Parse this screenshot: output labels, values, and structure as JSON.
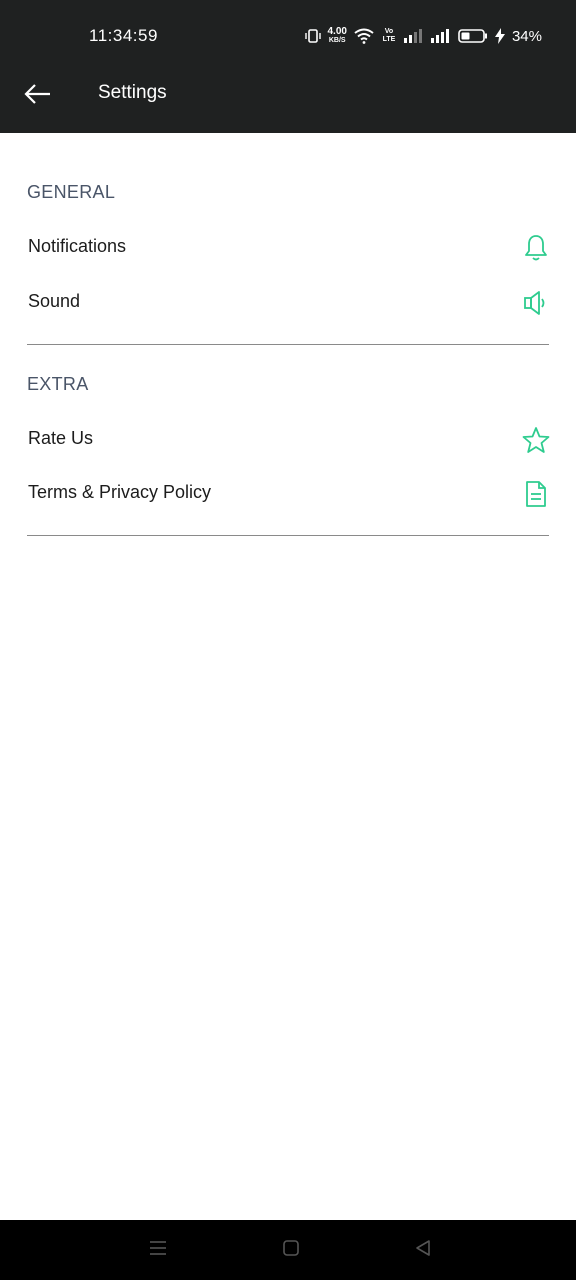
{
  "status_bar": {
    "time": "11:34:59",
    "net_speed_value": "4.00",
    "net_speed_unit": "KB/S",
    "volte": "Vo LTE",
    "battery_percent": "34%"
  },
  "app_bar": {
    "title": "Settings"
  },
  "sections": [
    {
      "header": "GENERAL",
      "items": [
        {
          "label": "Notifications",
          "icon": "bell-icon"
        },
        {
          "label": "Sound",
          "icon": "speaker-icon"
        }
      ]
    },
    {
      "header": "EXTRA",
      "items": [
        {
          "label": "Rate Us",
          "icon": "star-icon"
        },
        {
          "label": "Terms & Privacy Policy",
          "icon": "document-icon"
        }
      ]
    }
  ],
  "colors": {
    "app_bar_bg": "#1f2121",
    "accent_icon": "#2ecc8f",
    "section_header": "#4a5568",
    "divider": "#8a8a8a"
  },
  "nav_bar": {
    "buttons": [
      "menu-icon",
      "home-icon",
      "back-triangle-icon"
    ]
  }
}
